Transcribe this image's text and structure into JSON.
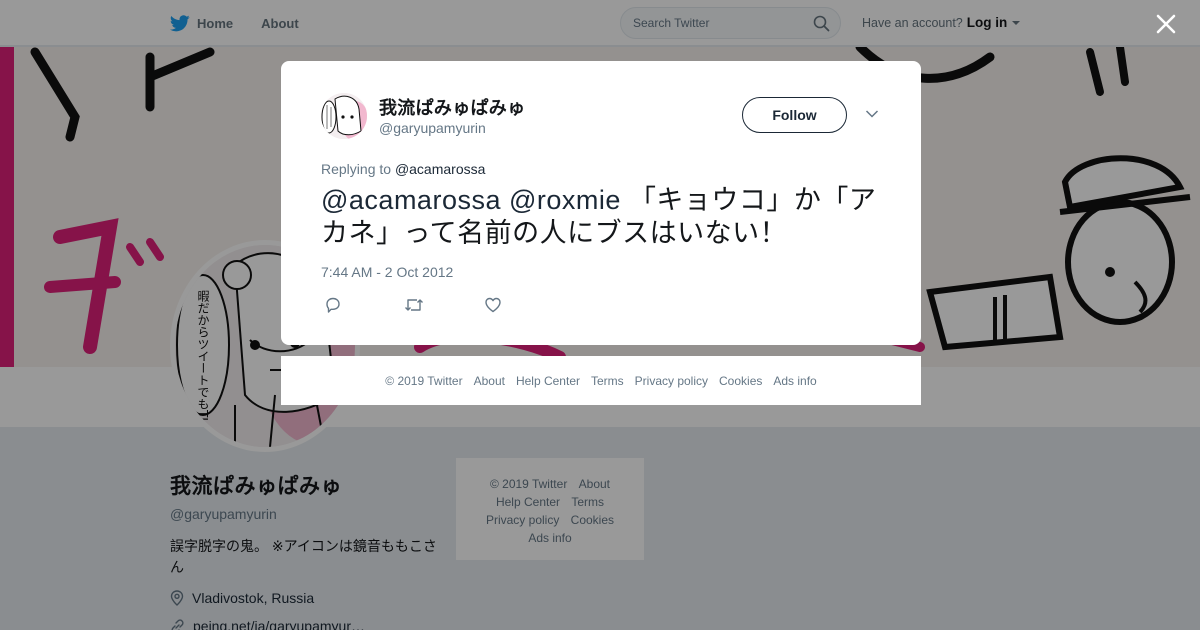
{
  "nav": {
    "home_label": "Home",
    "about_label": "About",
    "search_placeholder": "Search Twitter",
    "have_account": "Have an account?",
    "login_label": "Log in"
  },
  "profile": {
    "name": "我流ぱみゅぱみゅ",
    "handle": "@garyupamyurin",
    "bio": "誤字脱字の鬼。 ※アイコンは鏡音ももこさん",
    "location": "Vladivostok, Russia",
    "website": "peing.net/ja/garyupamyur…"
  },
  "avatar_art": {
    "speech_text": "暇だからツイートでもTLに流すか不穏"
  },
  "side_footer": {
    "copyright": "© 2019 Twitter",
    "about": "About",
    "help_center": "Help Center",
    "terms": "Terms",
    "privacy": "Privacy policy",
    "cookies": "Cookies",
    "ads_info": "Ads info"
  },
  "tweet": {
    "name": "我流ぱみゅぱみゅ",
    "handle": "@garyupamyurin",
    "follow_label": "Follow",
    "replying_prefix": "Replying to",
    "replying_to": "@acamarossa",
    "mention_1": "@acamarossa",
    "mention_2": "@roxmie",
    "body": "「キョウコ」か「アカネ」って名前の人にブスはいない！",
    "timestamp": "7:44 AM - 2 Oct 2012"
  },
  "modal_footer": {
    "copyright": "© 2019 Twitter",
    "about": "About",
    "help_center": "Help Center",
    "terms": "Terms",
    "privacy": "Privacy policy",
    "cookies": "Cookies",
    "ads_info": "Ads info"
  },
  "colors": {
    "brand_blue": "#1da1f2",
    "link_dark": "#1b2836",
    "banner_pink": "#e0207a",
    "overlay": "rgba(0,0,0,0.40)"
  },
  "icons": {
    "logo": "twitter-bird-icon",
    "search": "search-icon",
    "close": "close-icon",
    "more": "chevron-down-icon",
    "reply": "reply-icon",
    "retweet": "retweet-icon",
    "like": "heart-icon",
    "location": "location-pin-icon",
    "link": "link-icon"
  }
}
